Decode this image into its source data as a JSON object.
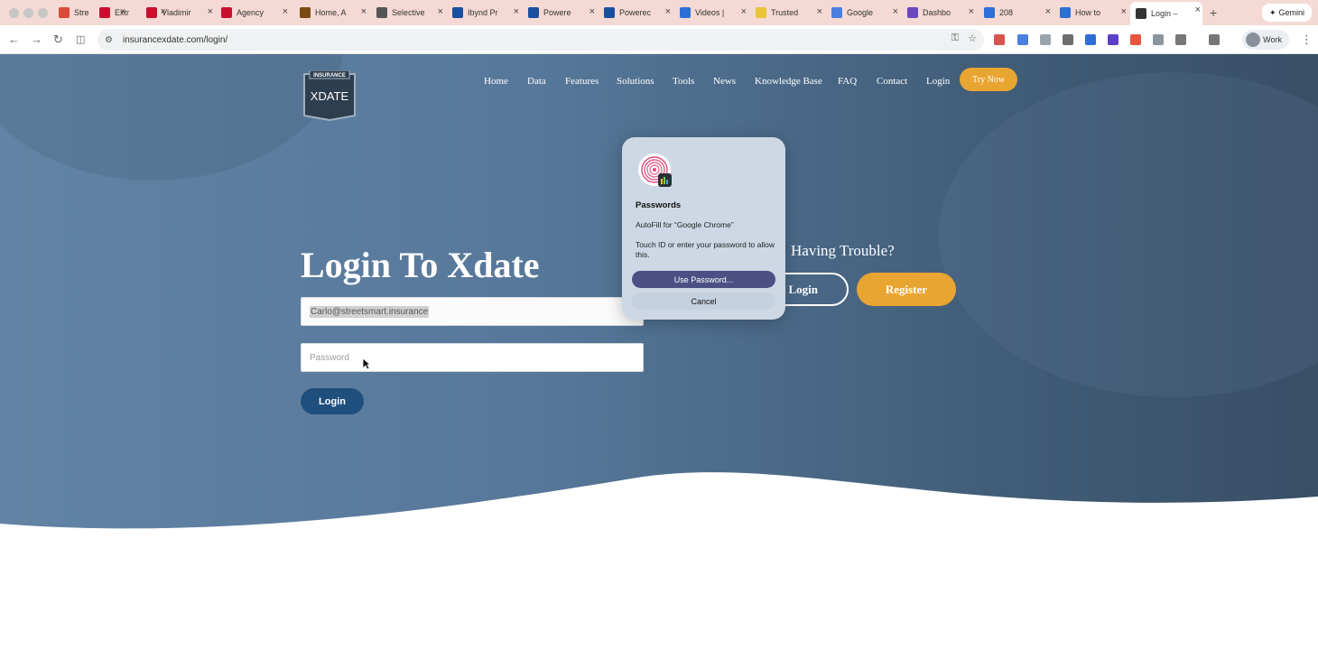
{
  "browser": {
    "tabs": [
      {
        "label": "Stre",
        "color": "#d94a38"
      },
      {
        "label": "Extr",
        "color": "#c8102e"
      },
      {
        "label": "Vladimir",
        "color": "#c8102e"
      },
      {
        "label": "Agency",
        "color": "#c8102e"
      },
      {
        "label": "Home, A",
        "color": "#7a4a12"
      },
      {
        "label": "Selective",
        "color": "#555555"
      },
      {
        "label": "Ibynd Pr",
        "color": "#1a4fa0"
      },
      {
        "label": "Powere",
        "color": "#1a4fa0"
      },
      {
        "label": "Powerec",
        "color": "#1a4fa0"
      },
      {
        "label": "Videos |",
        "color": "#2d6fd6"
      },
      {
        "label": "Trusted",
        "color": "#e9c33a"
      },
      {
        "label": "Google",
        "color": "#4a7fe0"
      },
      {
        "label": "Dashbo",
        "color": "#6b46c1"
      },
      {
        "label": "208",
        "color": "#2d6fd6"
      },
      {
        "label": "How to",
        "color": "#2d6fd6"
      },
      {
        "label": "Login –",
        "color": "#333333",
        "active": true
      }
    ],
    "new_tab": "+",
    "gemini_label": "Gemini",
    "url": "insurancexdate.com/login/",
    "profile_label": "Work"
  },
  "site": {
    "logo_top": "INSURANCE",
    "logo_main": "XDATE",
    "nav": [
      "Home",
      "Data",
      "Features",
      "Solutions",
      "Tools",
      "News",
      "Knowledge Base",
      "FAQ",
      "Contact",
      "Login"
    ],
    "try_now": "Try Now",
    "heading": "Login To Xdate",
    "email_value": "Carlo@streetsmart.insurance",
    "password_placeholder": "Password",
    "login_button": "Login",
    "trouble_text": "Having Trouble?",
    "outline_button": "t Login",
    "register_button": "Register",
    "colors": {
      "accent": "#e9a531",
      "primary": "#1f4f7d"
    }
  },
  "dialog": {
    "title": "Passwords",
    "autofill_text": "AutoFill for “Google Chrome”",
    "touch_text": "Touch ID or enter your password to allow this.",
    "use_password": "Use Password...",
    "cancel": "Cancel",
    "icon": "fingerprint-icon"
  }
}
